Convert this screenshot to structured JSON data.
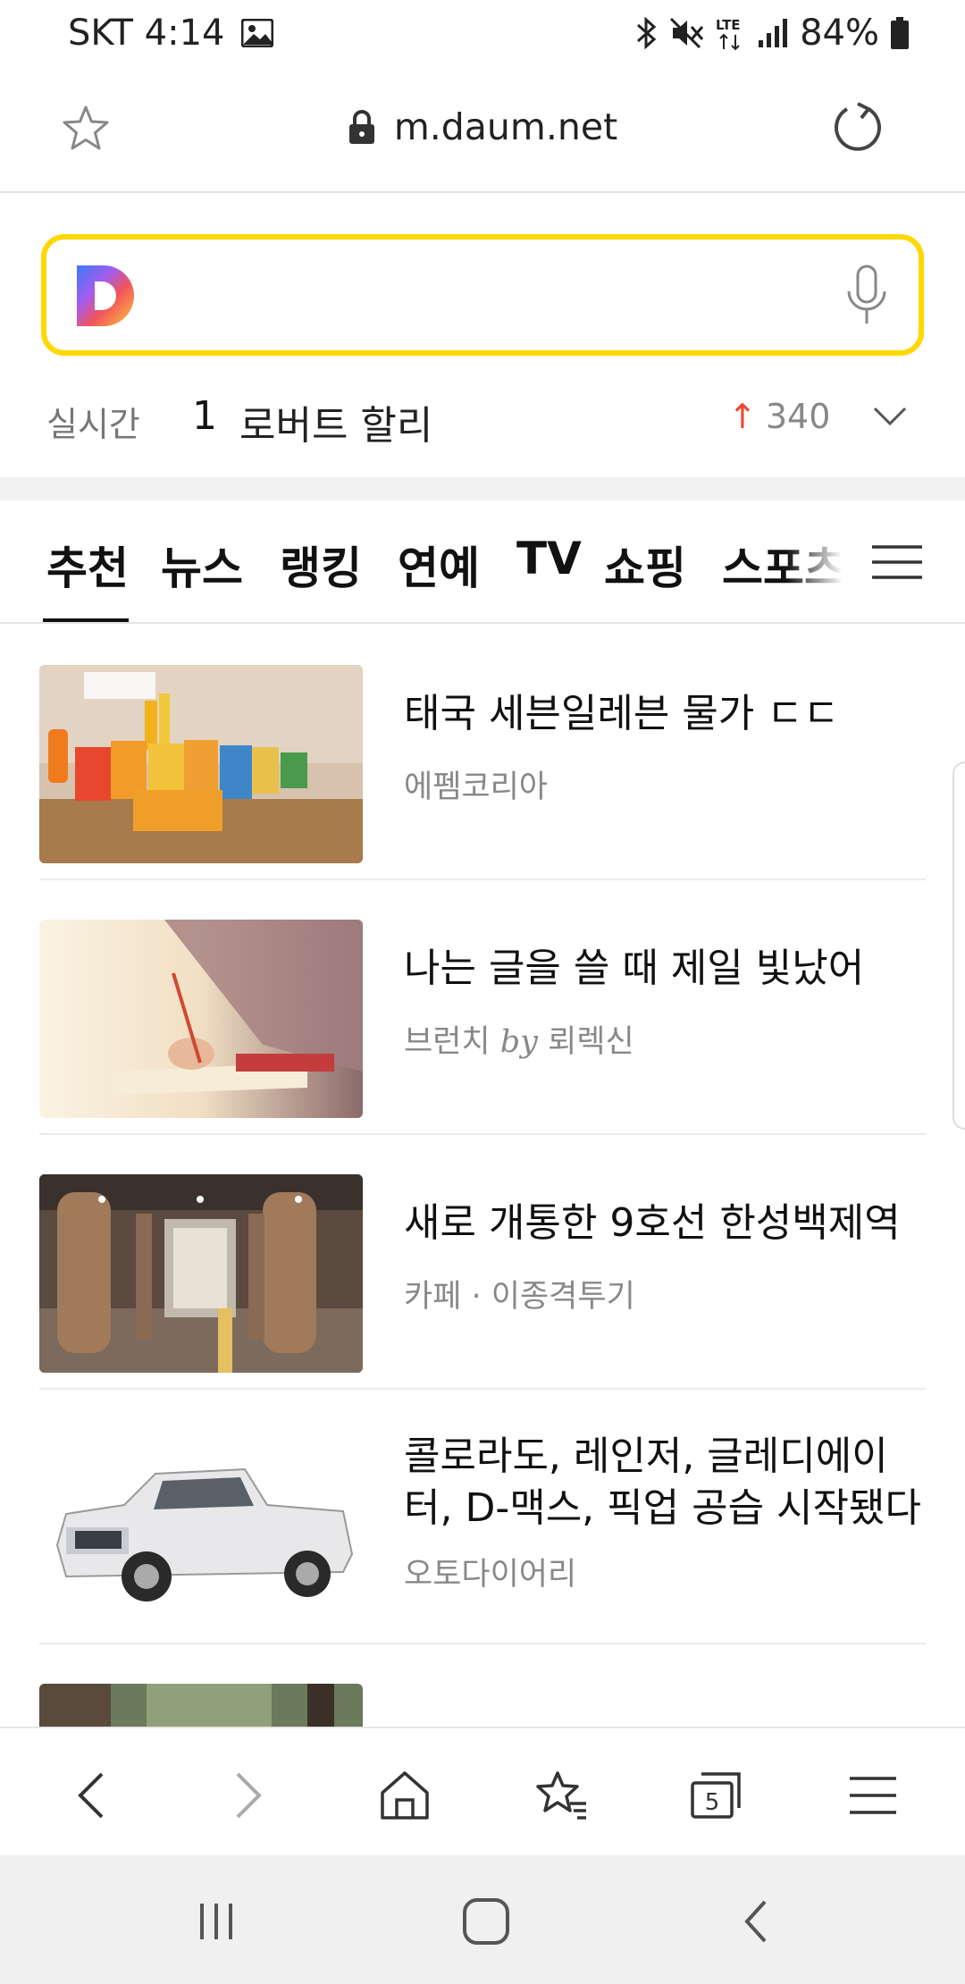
{
  "status_bar": {
    "carrier_time": "SKT 4:14",
    "battery": "84%",
    "network": "LTE",
    "icons": [
      "gallery-icon",
      "bluetooth-icon",
      "mute-icon",
      "lte-icon",
      "signal-icon",
      "battery-icon"
    ]
  },
  "url_bar": {
    "url": "m.daum.net",
    "icons": [
      "star-icon",
      "lock-icon",
      "reload-icon"
    ]
  },
  "search": {
    "placeholder": "",
    "brand_color": "#ffd800",
    "icons": [
      "daum-logo-icon",
      "mic-icon"
    ]
  },
  "realtime": {
    "label": "실시간",
    "rank": "1",
    "keyword": "로버트 할리",
    "trend_arrow": "↑",
    "trend_value": "340",
    "trend_color": "#ef4a2e"
  },
  "tabs": {
    "items": [
      {
        "label": "추천",
        "active": true
      },
      {
        "label": "뉴스"
      },
      {
        "label": "랭킹"
      },
      {
        "label": "연예"
      },
      {
        "label": "TV"
      },
      {
        "label": "쇼핑"
      },
      {
        "label": "스포츠"
      }
    ],
    "menu_icon": "hamburger-icon"
  },
  "feed": {
    "items": [
      {
        "title": "태국 세븐일레븐 물가 ㄷㄷ",
        "source": "에펨코리아"
      },
      {
        "title": "나는 글을 쓸 때 제일 빛났어",
        "source_prefix": "브런치",
        "source_by": "by",
        "source": "뢰렉신"
      },
      {
        "title": "새로 개통한 9호선 한성백제역",
        "source": "카페 · 이종격투기"
      },
      {
        "title_line1": "콜로라도, 레인저, 글레디에이",
        "title_line2": "터, D-맥스, 픽업 공습 시작됐다",
        "source": "오토다이어리"
      }
    ]
  },
  "toolbar": {
    "tab_count": "5",
    "icons": [
      "back-icon",
      "forward-icon",
      "home-icon",
      "bookmarks-icon",
      "tabs-icon",
      "menu-icon"
    ]
  },
  "nav_bar": {
    "icons": [
      "recents-icon",
      "home-icon",
      "back-icon"
    ]
  }
}
